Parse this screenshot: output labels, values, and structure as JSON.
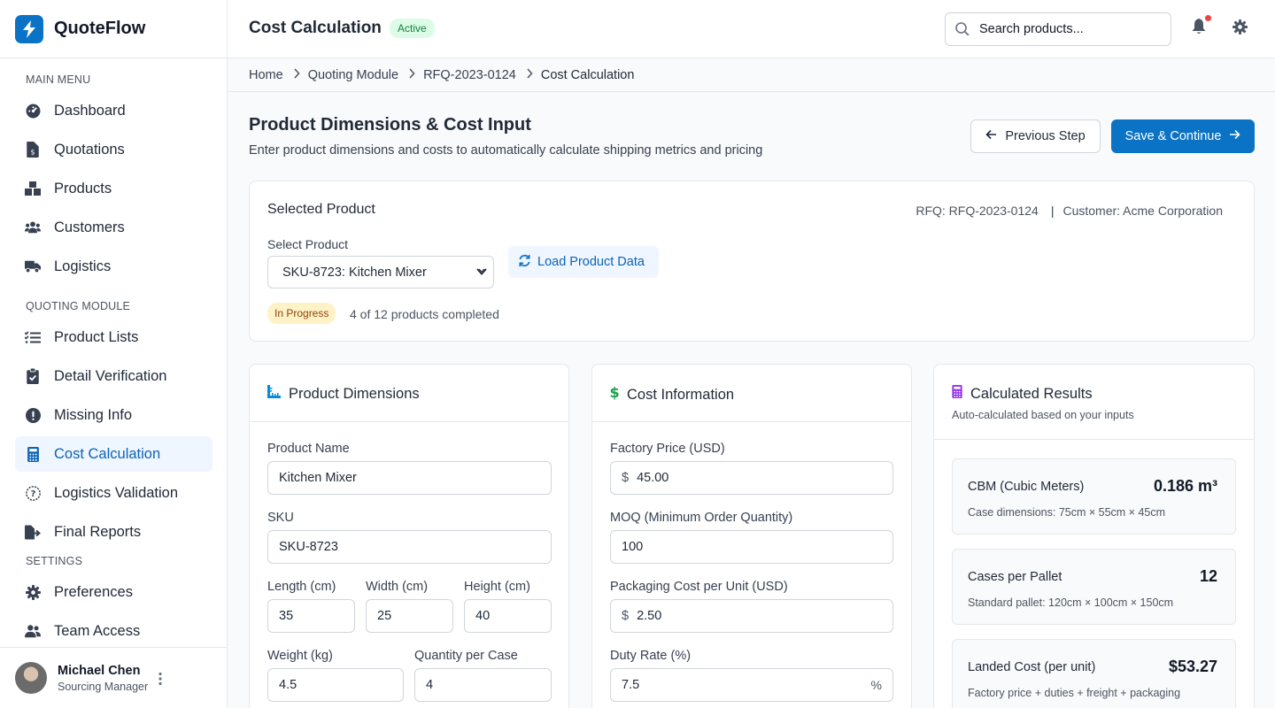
{
  "app": {
    "name": "QuoteFlow"
  },
  "sidebar": {
    "main_menu_label": "MAIN MENU",
    "main_items": [
      {
        "label": "Dashboard",
        "icon": "dashboard-icon"
      },
      {
        "label": "Quotations",
        "icon": "file-invoice-icon"
      },
      {
        "label": "Products",
        "icon": "boxes-icon"
      },
      {
        "label": "Customers",
        "icon": "users-icon"
      },
      {
        "label": "Logistics",
        "icon": "truck-icon"
      }
    ],
    "quoting_label": "QUOTING MODULE",
    "quoting_items": [
      {
        "label": "Product Lists",
        "icon": "list-check-icon"
      },
      {
        "label": "Detail Verification",
        "icon": "clipboard-check-icon"
      },
      {
        "label": "Missing Info",
        "icon": "exclamation-circle-icon"
      },
      {
        "label": "Cost Calculation",
        "icon": "calculator-icon",
        "active": true
      },
      {
        "label": "Logistics Validation",
        "icon": "question-circle-icon"
      },
      {
        "label": "Final Reports",
        "icon": "file-export-icon"
      }
    ],
    "settings_label": "SETTINGS",
    "settings_items": [
      {
        "label": "Preferences",
        "icon": "gear-icon"
      },
      {
        "label": "Team Access",
        "icon": "user-group-icon"
      }
    ],
    "user": {
      "name": "Michael Chen",
      "role": "Sourcing Manager"
    }
  },
  "header": {
    "title": "Cost Calculation",
    "status": "Active",
    "search_placeholder": "Search products..."
  },
  "breadcrumb": [
    "Home",
    "Quoting Module",
    "RFQ-2023-0124",
    "Cost Calculation"
  ],
  "main": {
    "title": "Product Dimensions & Cost Input",
    "subtitle": "Enter product dimensions and costs to automatically calculate shipping metrics and pricing",
    "prev_button": "Previous Step",
    "save_button": "Save & Continue"
  },
  "selected_product": {
    "title": "Selected Product",
    "rfq": "RFQ: RFQ-2023-0124",
    "customer": "Customer: Acme Corporation",
    "select_label": "Select Product",
    "select_value": "SKU-8723: Kitchen Mixer",
    "load_button": "Load Product Data",
    "status_badge": "In Progress",
    "progress_text": "4 of 12 products completed"
  },
  "dimensions": {
    "title": "Product Dimensions",
    "product_name_label": "Product Name",
    "product_name": "Kitchen Mixer",
    "sku_label": "SKU",
    "sku": "SKU-8723",
    "length_label": "Length (cm)",
    "length": "35",
    "width_label": "Width (cm)",
    "width": "25",
    "height_label": "Height (cm)",
    "height": "40",
    "weight_label": "Weight (kg)",
    "weight": "4.5",
    "qty_label": "Quantity per Case",
    "qty": "4"
  },
  "cost": {
    "title": "Cost Information",
    "factory_label": "Factory Price (USD)",
    "factory": "45.00",
    "moq_label": "MOQ (Minimum Order Quantity)",
    "moq": "100",
    "packaging_label": "Packaging Cost per Unit (USD)",
    "packaging": "2.50",
    "duty_label": "Duty Rate (%)",
    "duty": "7.5",
    "currency_symbol": "$",
    "percent_symbol": "%"
  },
  "results": {
    "title": "Calculated Results",
    "subtitle": "Auto-calculated based on your inputs",
    "cbm_label": "CBM (Cubic Meters)",
    "cbm_value": "0.186 m³",
    "cbm_note": "Case dimensions: 75cm × 55cm × 45cm",
    "cases_label": "Cases per Pallet",
    "cases_value": "12",
    "cases_note": "Standard pallet: 120cm × 100cm × 150cm",
    "landed_label": "Landed Cost (per unit)",
    "landed_value": "$53.27",
    "landed_note": "Factory price + duties + freight + packaging"
  },
  "colors": {
    "primary": "#0b73c5",
    "active_bg": "#eff6ff",
    "success_bg": "#dcfce7",
    "warning_bg": "#fef3c7"
  }
}
